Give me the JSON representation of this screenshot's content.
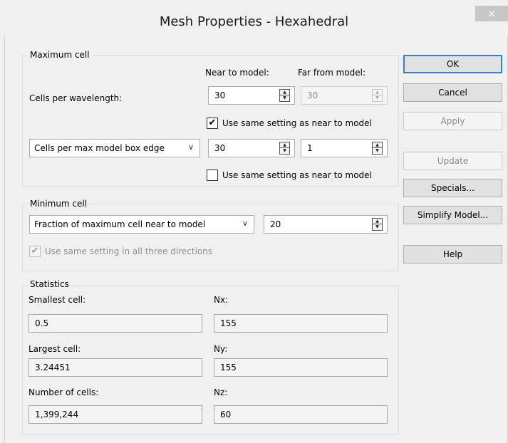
{
  "window": {
    "title": "Mesh Properties - Hexahedral",
    "close_glyph": "×"
  },
  "maximum_cell": {
    "group_label": "Maximum cell",
    "col_near": "Near to model:",
    "col_far": "Far from model:",
    "row1": {
      "label": "Cells per wavelength:",
      "near_value": "30",
      "far_value": "30",
      "same_setting": {
        "checked": true,
        "mark": "✔",
        "label": "Use same setting as near to model"
      }
    },
    "row2": {
      "selected": "Cells per max model box edge",
      "near_value": "30",
      "far_value": "1",
      "same_setting": {
        "checked": false,
        "mark": "",
        "label": "Use same setting as near to model"
      }
    }
  },
  "minimum_cell": {
    "group_label": "Minimum cell",
    "selected": "Fraction of maximum cell near to model",
    "value": "20",
    "all_directions": {
      "checked": true,
      "mark": "✔",
      "label": "Use same setting in all three directions"
    }
  },
  "statistics": {
    "group_label": "Statistics",
    "smallest_label": "Smallest cell:",
    "smallest_value": "0.5",
    "largest_label": "Largest cell:",
    "largest_value": "3.24451",
    "count_label": "Number of cells:",
    "count_value": "1,399,244",
    "nx_label": "Nx:",
    "nx_value": "155",
    "ny_label": "Ny:",
    "ny_value": "155",
    "nz_label": "Nz:",
    "nz_value": "60"
  },
  "buttons": {
    "ok": "OK",
    "cancel": "Cancel",
    "apply": "Apply",
    "update": "Update",
    "specials": "Specials...",
    "simplify": "Simplify Model...",
    "help": "Help"
  },
  "glyphs": {
    "up": "▲",
    "down": "▼",
    "chevron": "∨"
  },
  "icons": [
    "close-icon",
    "spin-up-arrow-icon",
    "spin-down-arrow-icon",
    "checkmark-icon",
    "chevron-down-icon"
  ]
}
